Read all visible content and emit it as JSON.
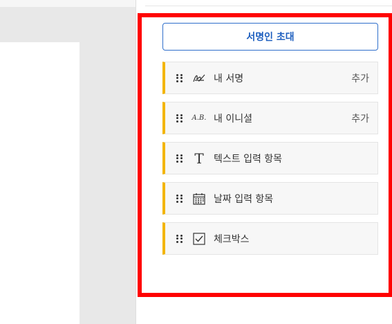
{
  "panel": {
    "invite_button": "서명인 초대",
    "fields": [
      {
        "icon": "signature-icon",
        "label": "내 서명",
        "action": "추가"
      },
      {
        "icon": "initials-icon",
        "label": "내 이니셜",
        "action": "추가",
        "icon_text": "A.B."
      },
      {
        "icon": "text-icon",
        "label": "텍스트 입력 항목",
        "icon_text": "T"
      },
      {
        "icon": "calendar-icon",
        "label": "날짜 입력 항목"
      },
      {
        "icon": "checkbox-icon",
        "label": "체크박스"
      }
    ]
  },
  "colors": {
    "accent": "#1e5fbf",
    "field_marker": "#f3b500",
    "highlight": "#ff0000"
  }
}
